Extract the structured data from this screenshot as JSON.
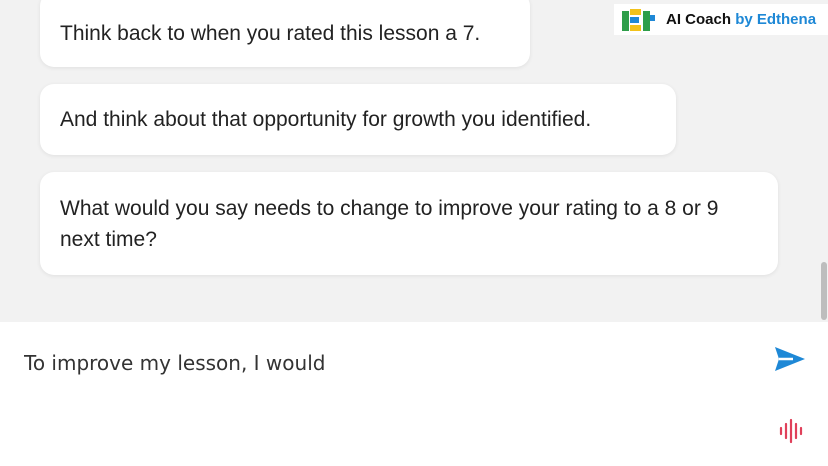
{
  "brand": {
    "name": "AI Coach",
    "by": "by Edthena",
    "logo_icon": "edthena-logo-icon",
    "accent_color": "#1e88d6"
  },
  "messages": [
    {
      "text": "Think back to when you rated this lesson a 7."
    },
    {
      "text": "And think about that opportunity for growth you identified."
    },
    {
      "text": "What would you say needs to change to improve your rating to a 8 or 9 next time?"
    }
  ],
  "composer": {
    "value": "To improve my lesson, I would",
    "send_icon": "send-icon",
    "send_color": "#1e88d6",
    "mic_icon": "voice-waveform-icon",
    "mic_color": "#e0405a"
  }
}
